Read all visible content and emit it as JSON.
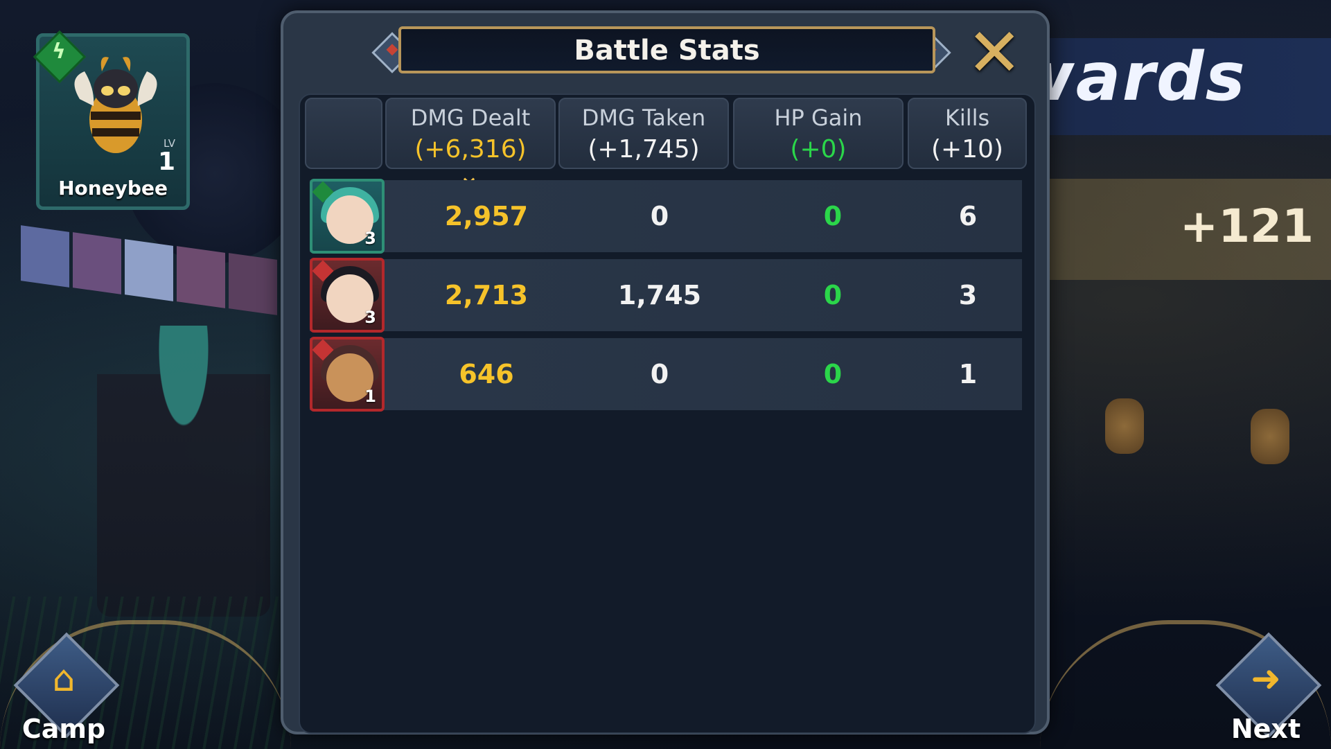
{
  "dialog": {
    "title": "Battle Stats",
    "close_icon": "close-x-icon"
  },
  "columns": [
    {
      "label": "DMG Dealt",
      "total": "(+6,316)",
      "color": "#f6c32a"
    },
    {
      "label": "DMG Taken",
      "total": "(+1,745)",
      "color": "#f2f2f2"
    },
    {
      "label": "HP Gain",
      "total": "(+0)",
      "color": "#2bd64a"
    },
    {
      "label": "Kills",
      "total": "(+10)",
      "color": "#f2f2f2"
    }
  ],
  "sort_indicator": "chevron-down-icon",
  "rows": [
    {
      "star": "3",
      "element": "lightning-icon",
      "border": "teal",
      "dealt": "2,957",
      "taken": "0",
      "hp": "0",
      "kills": "6"
    },
    {
      "star": "3",
      "element": "dagger-icon",
      "border": "red",
      "dealt": "2,713",
      "taken": "1,745",
      "hp": "0",
      "kills": "3"
    },
    {
      "star": "1",
      "element": "dagger-icon",
      "border": "red",
      "dealt": "646",
      "taken": "0",
      "hp": "0",
      "kills": "1"
    }
  ],
  "hero": {
    "name": "Honeybee",
    "level_label": "LV",
    "level": "1",
    "element_icon": "lightning-icon"
  },
  "background": {
    "rewards_title": "ewards",
    "reward_value": "+121"
  },
  "nav": {
    "camp_label": "Camp",
    "next_label": "Next"
  },
  "colors": {
    "gold": "#f6c32a",
    "green": "#2bd64a",
    "panel": "#2a3646",
    "accent": "#b8965a"
  }
}
